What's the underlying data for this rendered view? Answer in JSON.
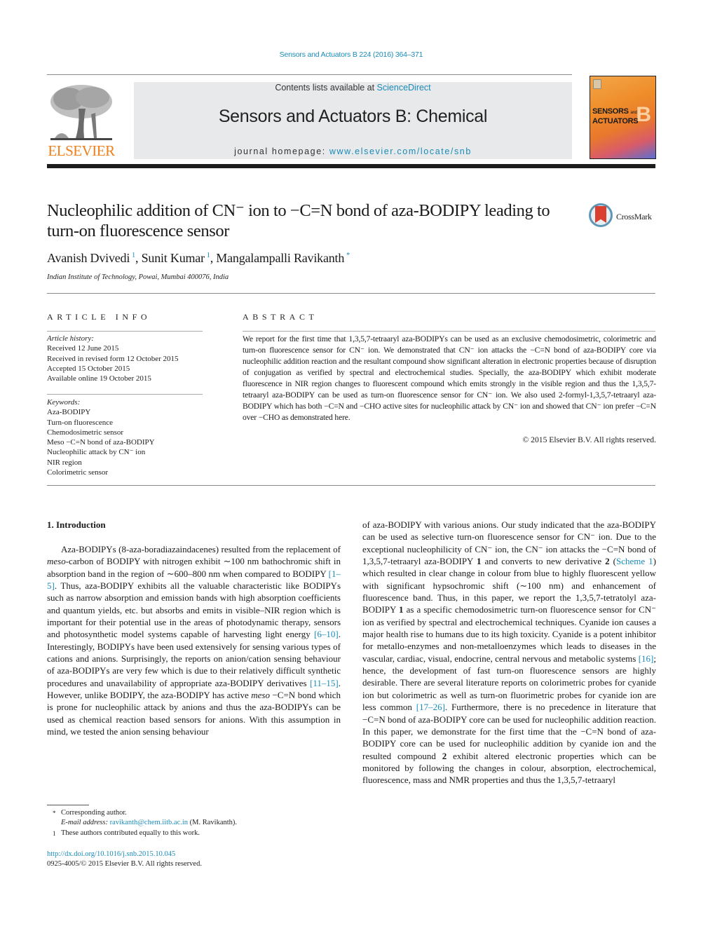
{
  "header": {
    "citation": "Sensors and Actuators B 224 (2016) 364–371",
    "contents_prefix": "Contents lists available at ",
    "contents_link": "ScienceDirect",
    "journal_name": "Sensors and Actuators B: Chemical",
    "homepage_prefix": "journal homepage: ",
    "homepage_link": "www.elsevier.com/locate/snb",
    "publisher_logo_text": "ELSEVIER",
    "cover": {
      "title_line1": "SENSORS",
      "title_and": "and",
      "title_line2": "ACTUATORS",
      "letter": "B"
    },
    "colors": {
      "link": "#1a8bb9",
      "elsevier_orange": "#ef7f1a",
      "rule_dark": "#1d1d1d"
    }
  },
  "article": {
    "title": "Nucleophilic addition of CN⁻ ion to −C=N bond of aza-BODIPY leading to turn-on fluorescence sensor",
    "crossmark_label": "CrossMark",
    "authors": [
      {
        "name": "Avanish Dvivedi",
        "mark": "1"
      },
      {
        "name": "Sunit Kumar",
        "mark": "1"
      },
      {
        "name": "Mangalampalli Ravikanth",
        "mark": "*"
      }
    ],
    "affiliation": "Indian Institute of Technology, Powai, Mumbai 400076, India"
  },
  "article_info": {
    "heading": "ARTICLE INFO",
    "history_label": "Article history:",
    "history": [
      "Received 12 June 2015",
      "Received in revised form 12 October 2015",
      "Accepted 15 October 2015",
      "Available online 19 October 2015"
    ],
    "keywords_label": "Keywords:",
    "keywords": [
      "Aza-BODIPY",
      "Turn-on fluorescence",
      "Chemodosimetric sensor",
      "Meso −C=N bond of aza-BODIPY",
      "Nucleophilic attack by CN⁻ ion",
      "NIR region",
      "Colorimetric sensor"
    ]
  },
  "abstract": {
    "heading": "ABSTRACT",
    "text": "We report for the first time that 1,3,5,7-tetraaryl aza-BODIPYs can be used as an exclusive chemodosimetric, colorimetric and turn-on fluorescence sensor for CN⁻ ion. We demonstrated that CN⁻ ion attacks the −C=N bond of aza-BODIPY core via nucleophilic addition reaction and the resultant compound show significant alteration in electronic properties because of disruption of conjugation as verified by spectral and electrochemical studies. Specially, the aza-BODIPY which exhibit moderate fluorescence in NIR region changes to fluorescent compound which emits strongly in the visible region and thus the 1,3,5,7-tetraaryl aza-BODIPY can be used as turn-on fluorescence sensor for CN⁻ ion. We also used 2-formyl-1,3,5,7-tetraaryl aza-BODIPY which has both −C=N and −CHO active sites for nucleophilic attack by CN⁻ ion and showed that CN⁻ ion prefer −C=N over −CHO as demonstrated here.",
    "copyright": "© 2015 Elsevier B.V. All rights reserved."
  },
  "body": {
    "section_heading": "1.  Introduction",
    "left": [
      {
        "t": "Aza-BODIPYs (8-aza-boradiazaindacenes) resulted from the replacement of "
      },
      {
        "t": "meso",
        "style": "i"
      },
      {
        "t": "-carbon of BODIPY with nitrogen exhibit ∼100 nm bathochromic shift in absorption band in the region of ∼600–800 nm when compared to BODIPY "
      },
      {
        "t": "[1–5]",
        "style": "link"
      },
      {
        "t": ". Thus, aza-BODIPY exhibits all the valuable characteristic like BODIPYs such as narrow absorption and emission bands with high absorption coefficients and quantum yields, etc. but absorbs and emits in visible–NIR region which is important for their potential use in the areas of photodynamic therapy, sensors and photosynthetic model systems capable of harvesting light energy "
      },
      {
        "t": "[6–10]",
        "style": "link"
      },
      {
        "t": ". Interestingly, BODIPYs have been used extensively for sensing various types of cations and anions. Surprisingly, the reports on anion/cation sensing behaviour of aza-BODIPYs are very few which is due to their relatively difficult synthetic procedures and unavailability of appropriate aza-BODIPY derivatives "
      },
      {
        "t": "[11–15]",
        "style": "link"
      },
      {
        "t": ". However, unlike BODIPY, the aza-BODIPY has active "
      },
      {
        "t": "meso",
        "style": "i"
      },
      {
        "t": " −C=N bond which is prone for nucleophilic attack by anions and thus the aza-BODIPYs can be used as chemical reaction based sensors for anions. With this assumption in mind, we tested the anion sensing behaviour"
      }
    ],
    "right": [
      {
        "t": "of aza-BODIPY with various anions. Our study indicated that the aza-BODIPY can be used as selective turn-on fluorescence sensor for CN⁻ ion. Due to the exceptional nucleophilicity of CN⁻ ion, the CN⁻ ion attacks the −C=N bond of 1,3,5,7-tetraaryl aza-BODIPY "
      },
      {
        "t": "1",
        "style": "b"
      },
      {
        "t": " and converts to new derivative "
      },
      {
        "t": "2",
        "style": "b"
      },
      {
        "t": " ("
      },
      {
        "t": "Scheme 1",
        "style": "link"
      },
      {
        "t": ") which resulted in clear change in colour from blue to highly fluorescent yellow with significant hypsochromic shift (∼100 nm) and enhancement of fluorescence band. Thus, in this paper, we report the 1,3,5,7-tetratolyl aza-BODIPY "
      },
      {
        "t": "1",
        "style": "b"
      },
      {
        "t": " as a specific chemodosimetric turn-on fluorescence sensor for CN⁻ ion as verified by spectral and electrochemical techniques. Cyanide ion causes a major health rise to humans due to its high toxicity. Cyanide is a potent inhibitor for metallo-enzymes and non-metalloenzymes which leads to diseases in the vascular, cardiac, visual, endocrine, central nervous and metabolic systems "
      },
      {
        "t": "[16]",
        "style": "link"
      },
      {
        "t": "; hence, the development of fast turn-on fluorescence sensors are highly desirable. There are several literature reports on colorimetric probes for cyanide ion but colorimetric as well as turn-on fluorimetric probes for cyanide ion are less common "
      },
      {
        "t": "[17–26]",
        "style": "link"
      },
      {
        "t": ". Furthermore, there is no precedence in literature that −C=N bond of aza-BODIPY core can be used for nucleophilic addition reaction. In this paper, we demonstrate for the first time that the −C=N bond of aza-BODIPY core can be used for nucleophilic addition by cyanide ion and the resulted compound "
      },
      {
        "t": "2",
        "style": "b"
      },
      {
        "t": " exhibit altered electronic properties which can be monitored by following the changes in colour, absorption, electrochemical, fluorescence, mass and NMR properties and thus the 1,3,5,7-tetraaryl"
      }
    ]
  },
  "footnotes": {
    "corresponding_mark": "*",
    "corresponding": "Corresponding author.",
    "email_label": "E-mail address: ",
    "email": "ravikanth@chem.iitb.ac.in",
    "email_suffix": " (M. Ravikanth).",
    "equal_mark": "1",
    "equal": "These authors contributed equally to this work.",
    "doi": "http://dx.doi.org/10.1016/j.snb.2015.10.045",
    "issn": "0925-4005/© 2015 Elsevier B.V. All rights reserved."
  }
}
